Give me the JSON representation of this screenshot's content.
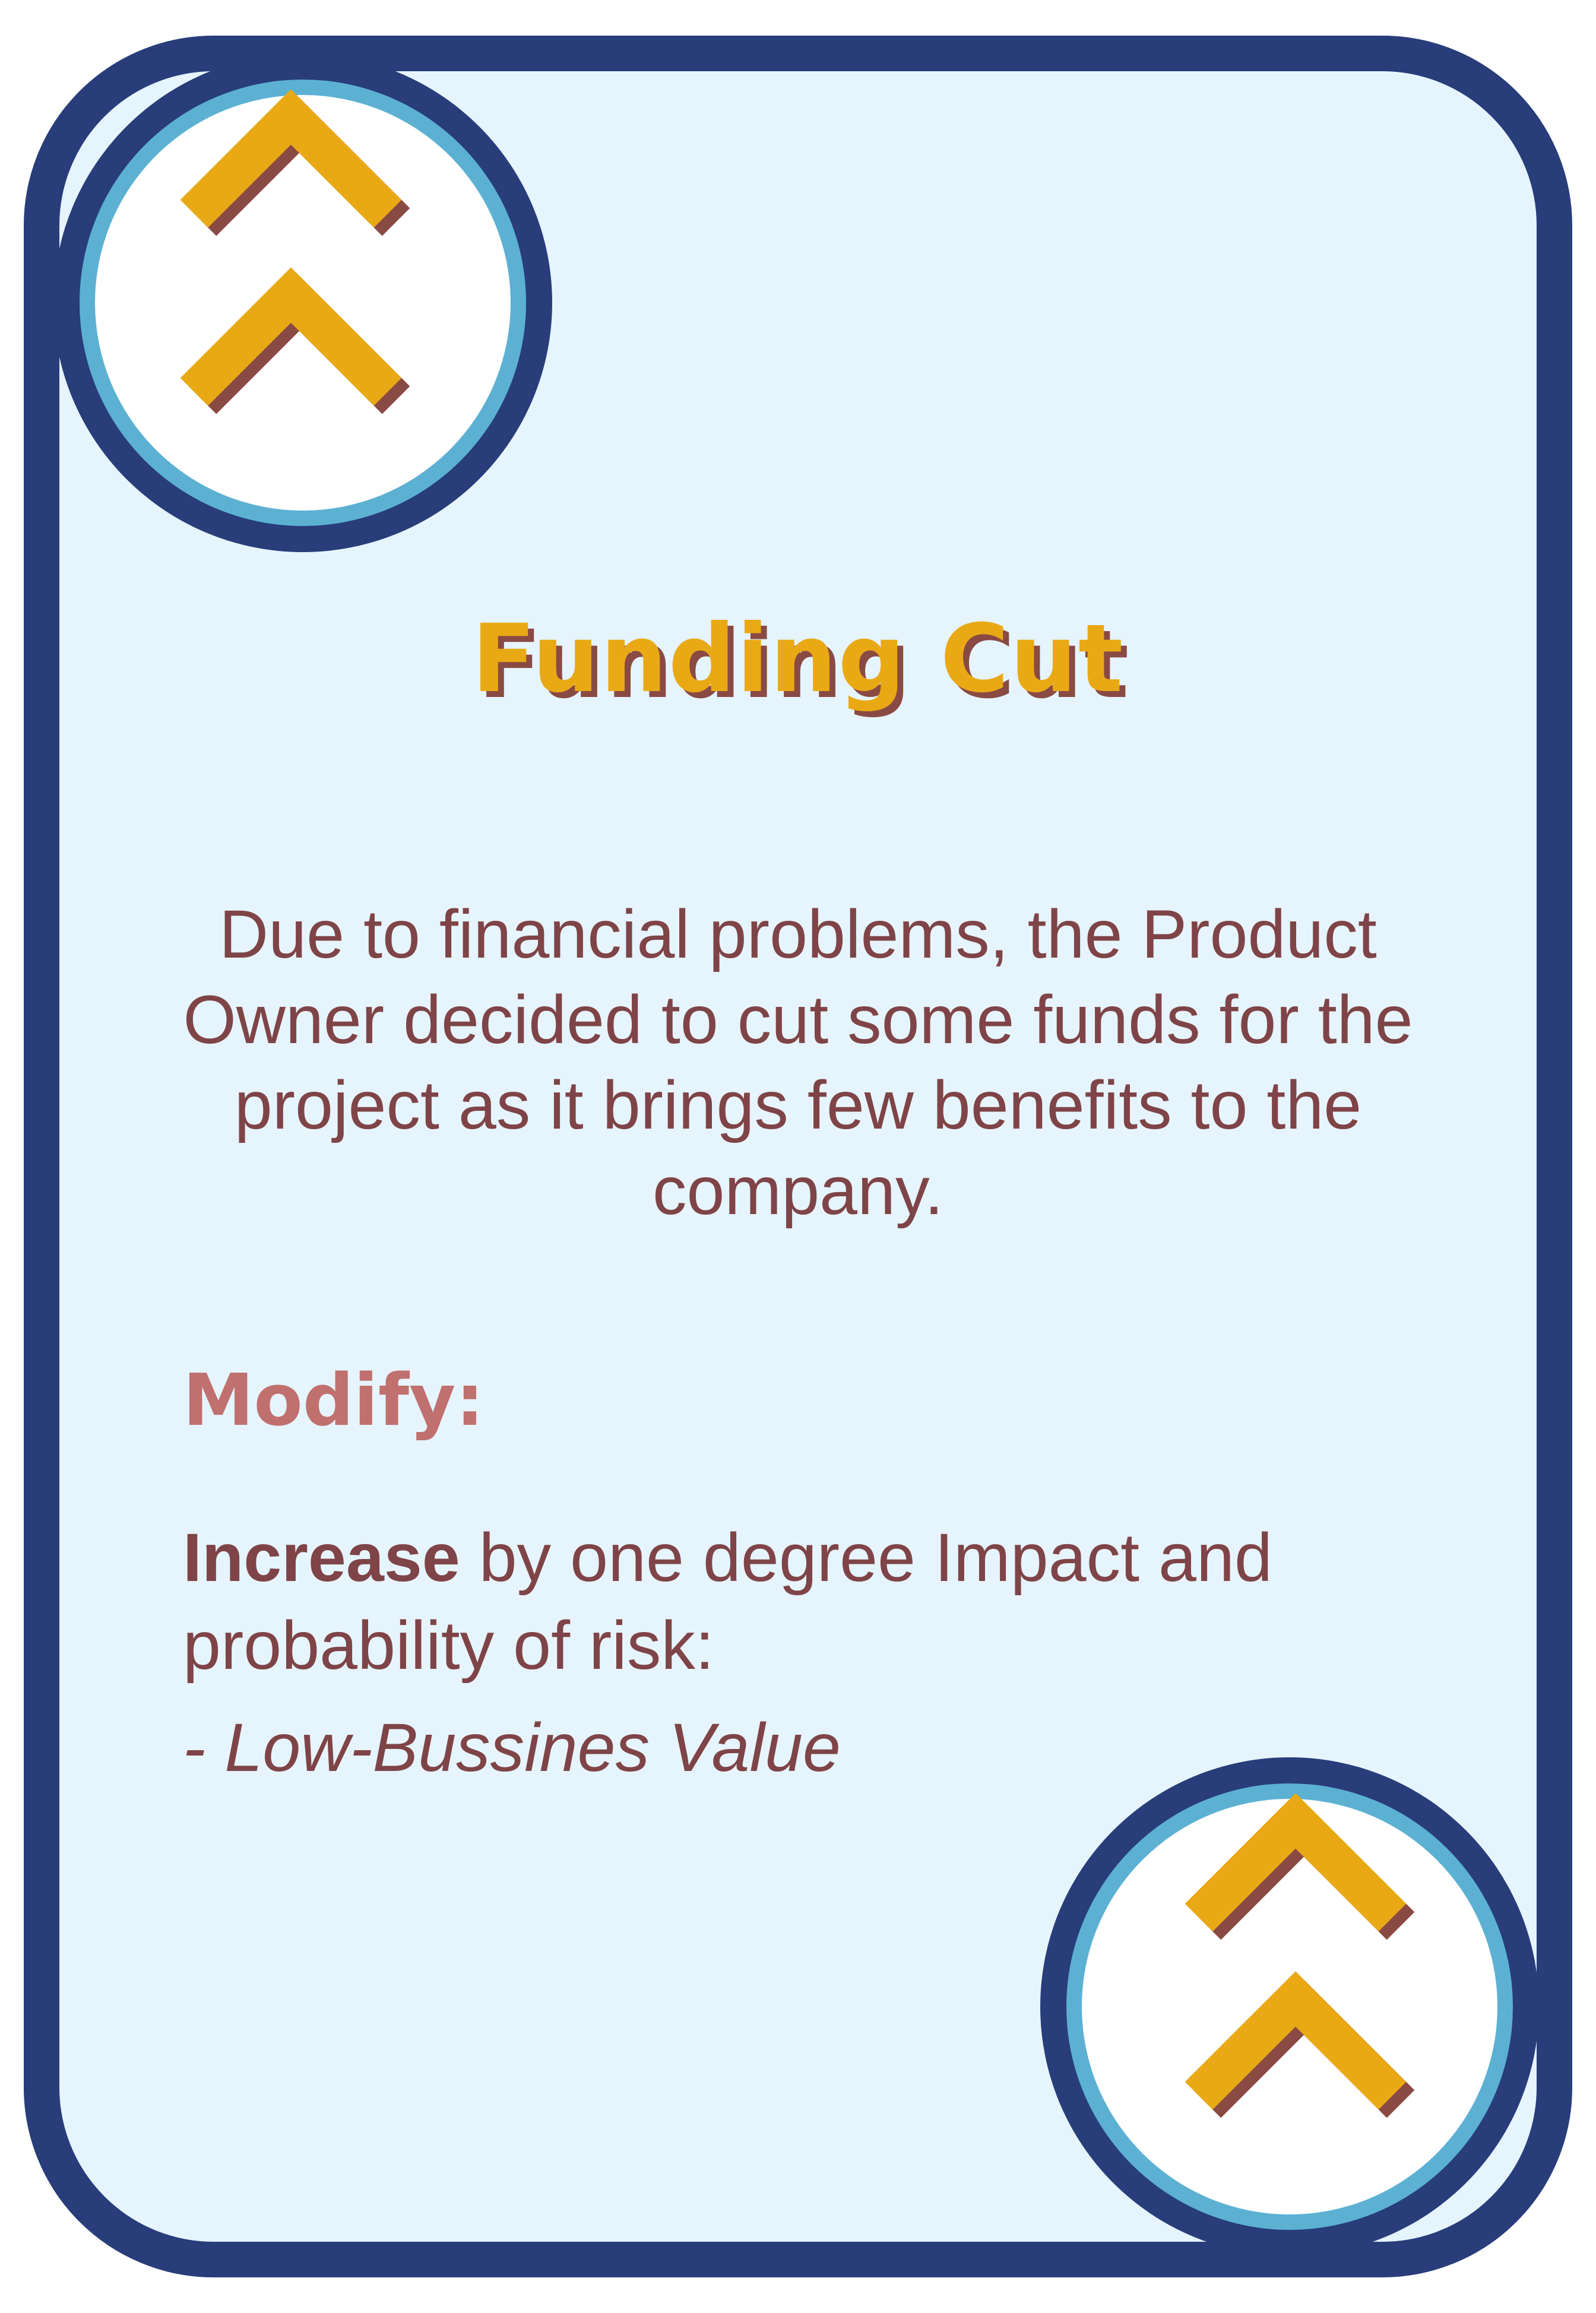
{
  "card": {
    "title": "Funding Cut",
    "description": "Due to financial problems, the Product Owner decided to cut some funds for the project as it brings few benefits to the company.",
    "modify_heading": "Modify:",
    "effect_action": "Increase",
    "effect_text": " by one degree Impact and probability of risk:",
    "effect_detail": "- Low-Bussines Value",
    "icon_top": "double-chevron-up-icon",
    "icon_bottom": "double-chevron-up-icon"
  },
  "colors": {
    "border": "#283d7a",
    "ring": "#5cb1d3",
    "background": "#e6f4fd",
    "accent": "#e9a915",
    "shadow": "#8a4a44",
    "text": "#7f4447",
    "heading": "#c0706e"
  }
}
